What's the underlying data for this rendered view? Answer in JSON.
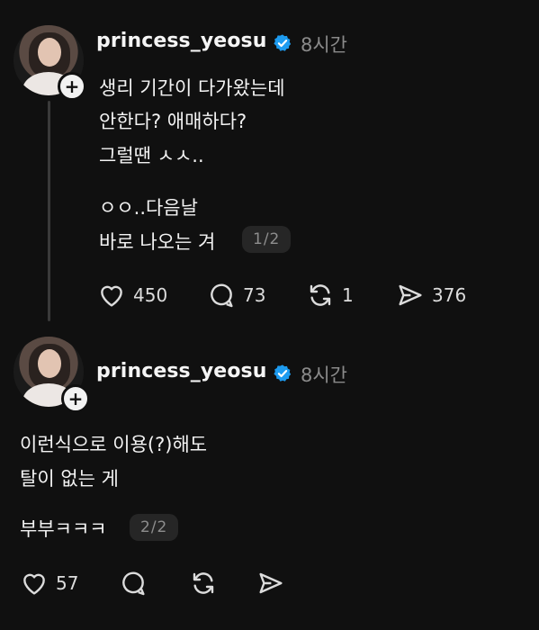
{
  "post1": {
    "username": "princess_yeosu",
    "time": "8시간",
    "lines": [
      "생리 기간이 다가왔는데",
      "안한다?  애매하다?",
      "그럴땐 ㅅㅅ..",
      "ㅇㅇ..다음날",
      "바로 나오는 겨"
    ],
    "pager": "1/2",
    "actions": {
      "likes": "450",
      "comments": "73",
      "reposts": "1",
      "shares": "376"
    }
  },
  "post2": {
    "username": "princess_yeosu",
    "time": "8시간",
    "lines": [
      "이런식으로 이용(?)해도",
      "탈이 없는 게",
      "부부ㅋㅋㅋ"
    ],
    "pager": "2/2",
    "actions": {
      "likes": "57"
    }
  },
  "icons": {
    "verified_color": "#1d9bf0",
    "like": "heart-icon",
    "comment": "comment-icon",
    "repost": "repost-icon",
    "share": "send-icon"
  }
}
